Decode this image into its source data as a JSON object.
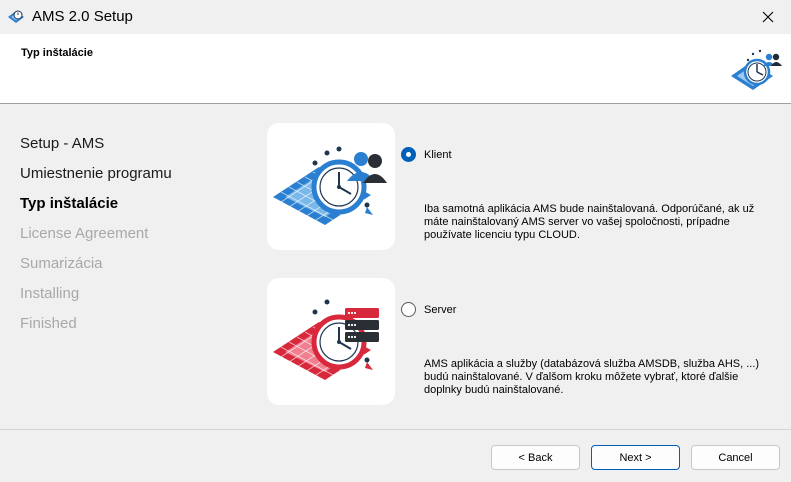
{
  "window": {
    "title": "AMS 2.0 Setup",
    "close_icon": "close-icon",
    "app_icon": "ams-logo-icon"
  },
  "header": {
    "title": "Typ inštalácie",
    "logo_icon": "ams-logo-icon"
  },
  "steps": [
    {
      "label": "Setup - AMS",
      "state": "done"
    },
    {
      "label": "Umiestnenie programu",
      "state": "done"
    },
    {
      "label": "Typ inštalácie",
      "state": "current"
    },
    {
      "label": "License Agreement",
      "state": "disabled"
    },
    {
      "label": "Sumarizácia",
      "state": "disabled"
    },
    {
      "label": "Installing",
      "state": "disabled"
    },
    {
      "label": "Finished",
      "state": "disabled"
    }
  ],
  "options": [
    {
      "label": "Klient",
      "selected": true,
      "description": "Iba samotná aplikácia AMS bude nainštalovaná. Odporúčané, ak už máte nainštalovaný AMS server vo vašej spoločnosti, prípadne používate licenciu typu CLOUD.",
      "icon": "client-users-icon"
    },
    {
      "label": "Server",
      "selected": false,
      "description": "AMS aplikácia a služby (databázová služba AMSDB, služba AHS, ...) budú nainštalované. V ďalšom kroku môžete vybrať, ktoré ďalšie doplnky budú nainštalované.",
      "icon": "server-stack-icon"
    }
  ],
  "buttons": {
    "back": "< Back",
    "next": "Next >",
    "cancel": "Cancel"
  },
  "colors": {
    "accent": "#005fb8",
    "client_blue": "#2a7fd0",
    "server_red": "#d8283c"
  }
}
